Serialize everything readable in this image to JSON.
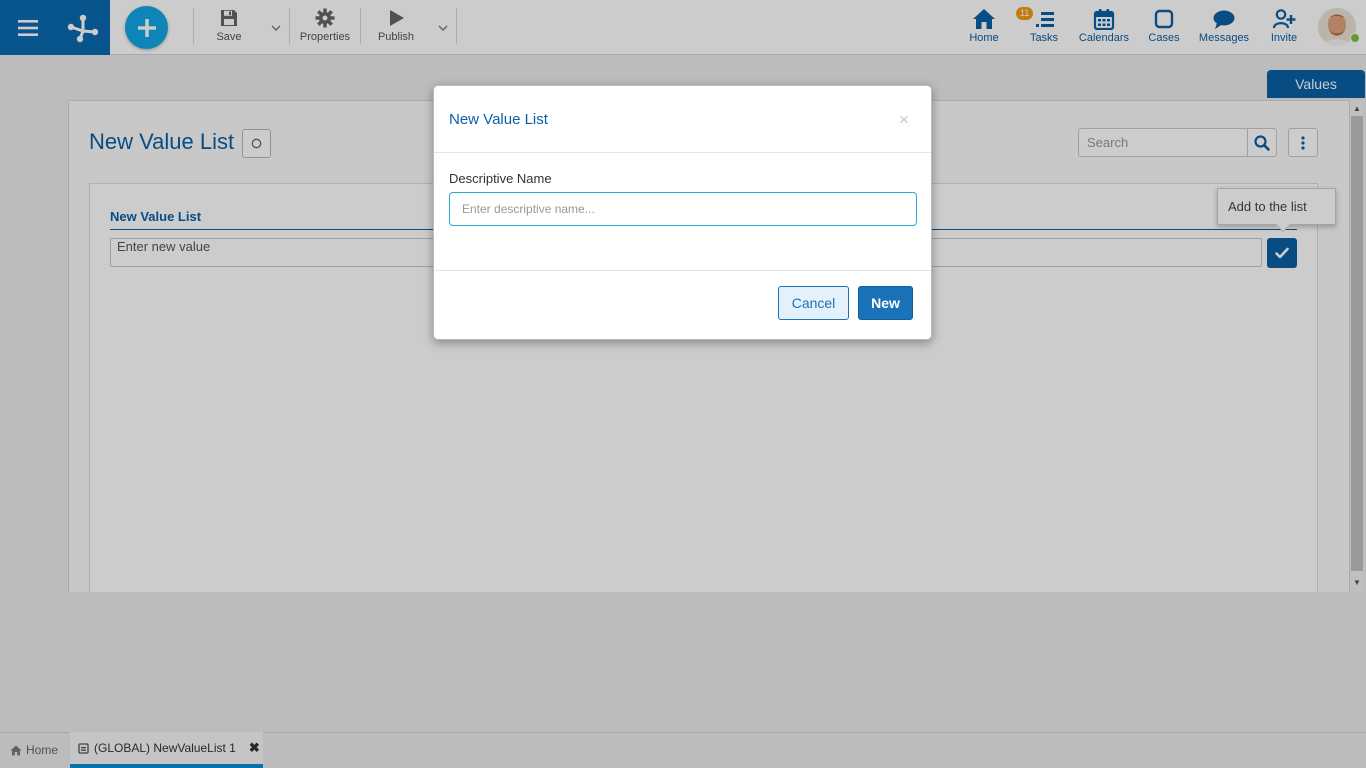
{
  "toolbar": {
    "save_label": "Save",
    "properties_label": "Properties",
    "publish_label": "Publish"
  },
  "nav": {
    "home_label": "Home",
    "tasks_label": "Tasks",
    "tasks_badge": "11",
    "calendars_label": "Calendars",
    "cases_label": "Cases",
    "messages_label": "Messages",
    "invite_label": "Invite"
  },
  "workspace": {
    "values_tab_label": "Values",
    "page_title": "New Value List",
    "search_placeholder": "Search",
    "section_title": "New Value List",
    "new_value_placeholder": "Enter new value",
    "tooltip_text": "Add to the list"
  },
  "modal": {
    "title": "New Value List",
    "close_glyph": "×",
    "field_label": "Descriptive Name",
    "field_placeholder": "Enter descriptive name...",
    "cancel_label": "Cancel",
    "new_label": "New"
  },
  "tabs": {
    "home_label": "Home",
    "doc_label": "(GLOBAL) NewValueList 1",
    "close_glyph": "✖"
  },
  "colors": {
    "brand_blue": "#0b5fa5",
    "plus_blue": "#12a7e8",
    "badge_orange": "#f39c12",
    "online_green": "#7fc241",
    "active_tab": "#0b8fd6"
  }
}
